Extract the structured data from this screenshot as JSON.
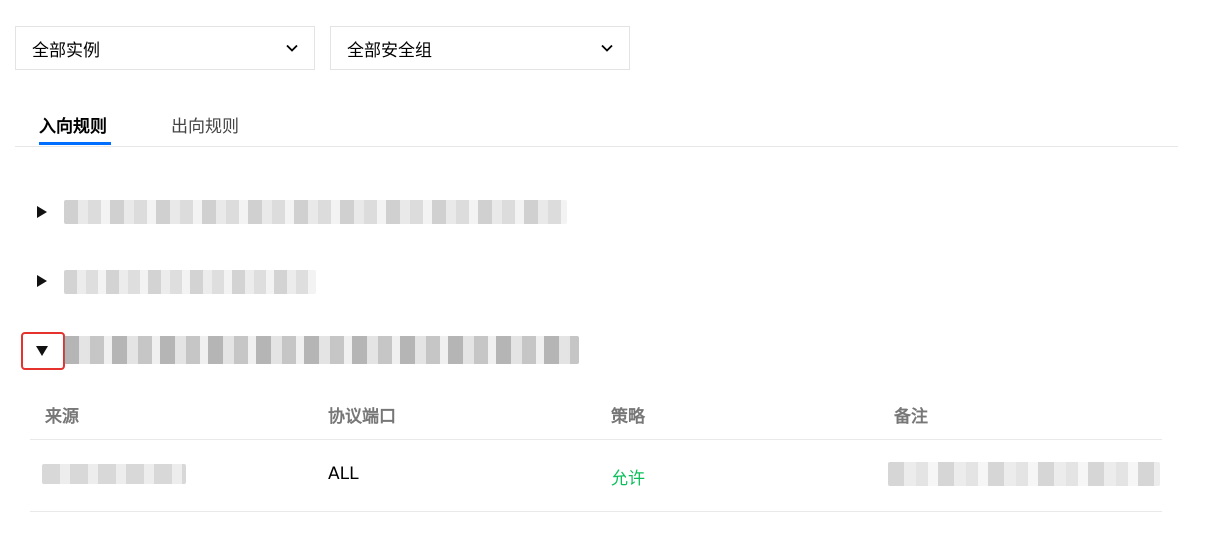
{
  "filters": {
    "instance_select": {
      "value": "全部实例",
      "icon": "chevron-down-icon"
    },
    "security_group_select": {
      "value": "全部安全组",
      "icon": "chevron-down-icon"
    }
  },
  "tabs": [
    {
      "label": "入向规则",
      "active": true
    },
    {
      "label": "出向规则",
      "active": false
    }
  ],
  "colors": {
    "accent": "#006eff",
    "allow": "#0abf5b",
    "highlight_border": "#e5322d"
  },
  "groups": [
    {
      "expanded": false,
      "icon": "triangle-right-icon"
    },
    {
      "expanded": false,
      "icon": "triangle-right-icon"
    },
    {
      "expanded": true,
      "icon": "triangle-down-icon"
    }
  ],
  "rules_table": {
    "columns": [
      "来源",
      "协议端口",
      "策略",
      "备注"
    ],
    "rows": [
      {
        "protocol_port": "ALL",
        "policy": "允许"
      }
    ]
  }
}
